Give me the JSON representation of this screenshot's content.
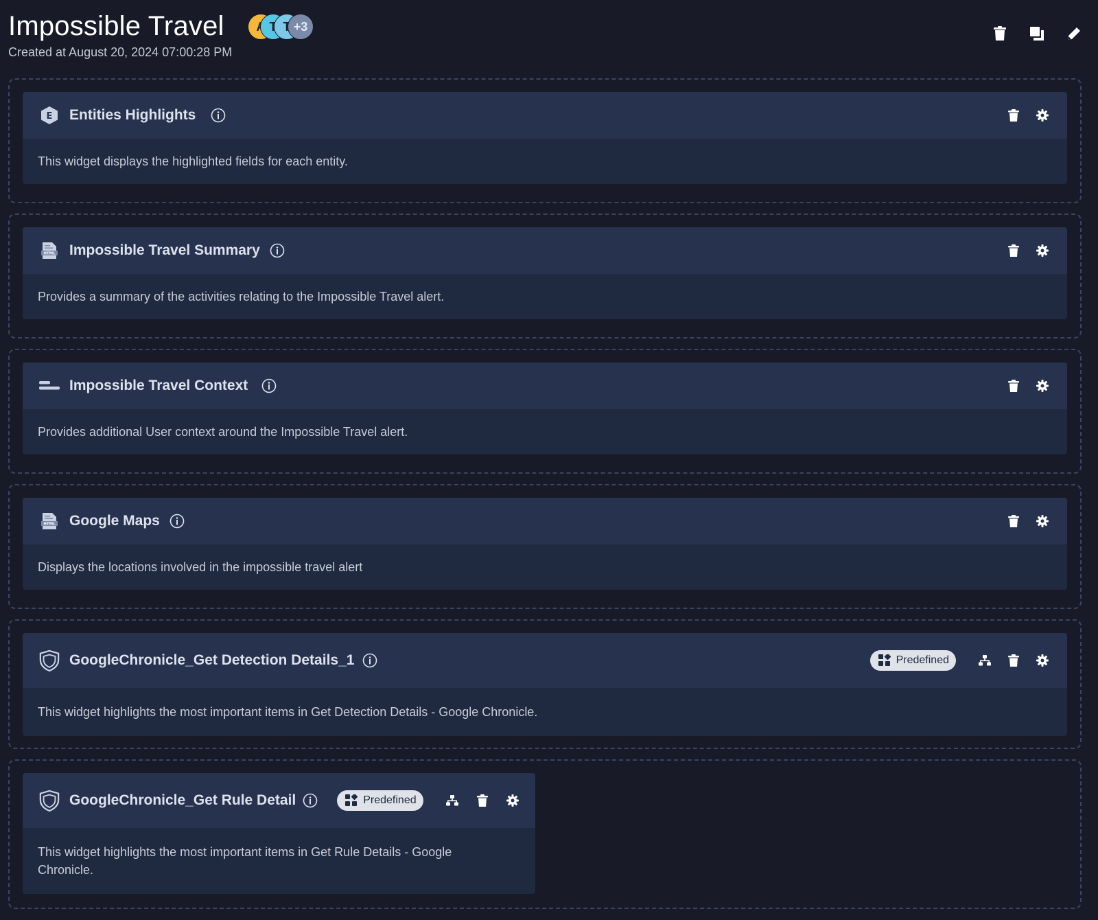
{
  "page": {
    "title": "Impossible Travel",
    "subtitle": "Created at August 20, 2024 07:00:28 PM"
  },
  "avatars": [
    {
      "initial": "A",
      "color": "#f4b73a"
    },
    {
      "initial": "T",
      "color": "#57c7e3"
    },
    {
      "initial": "T",
      "color": "#7ec8e8"
    },
    {
      "initial": "+3",
      "color": "#7a8aa8"
    }
  ],
  "top_actions": [
    "trash-icon",
    "copy-icon",
    "pencil-icon"
  ],
  "widgets": [
    {
      "title": "Entities Highlights",
      "icon": "entity-hexagon-icon",
      "description": "This widget displays the highlighted fields for each entity."
    },
    {
      "title": "Impossible Travel Summary",
      "icon": "html-file-icon",
      "description": "Provides a summary of the activities relating to the Impossible Travel alert."
    },
    {
      "title": "Impossible Travel Context",
      "icon": "text-lines-icon",
      "description": "Provides additional User context around the Impossible Travel alert."
    },
    {
      "title": "Google Maps",
      "icon": "html-file-icon",
      "description": "Displays the locations involved in the impossible travel alert"
    },
    {
      "title": "GoogleChronicle_Get Detection Details_1",
      "icon": "shield-icon",
      "badge": "Predefined",
      "description": "This widget highlights the most important items in Get Detection Details - Google Chronicle."
    },
    {
      "title": "GoogleChronicle_Get Rule Detail",
      "icon": "shield-icon",
      "badge": "Predefined",
      "description": "This widget highlights the most important items in Get Rule Details - Google Chronicle."
    }
  ],
  "colors": {
    "background": "#181a28",
    "widget_header": "#27334e",
    "widget_body": "#1f2940",
    "zone_border": "#3b4560",
    "badge_bg": "#dfe2e9"
  }
}
